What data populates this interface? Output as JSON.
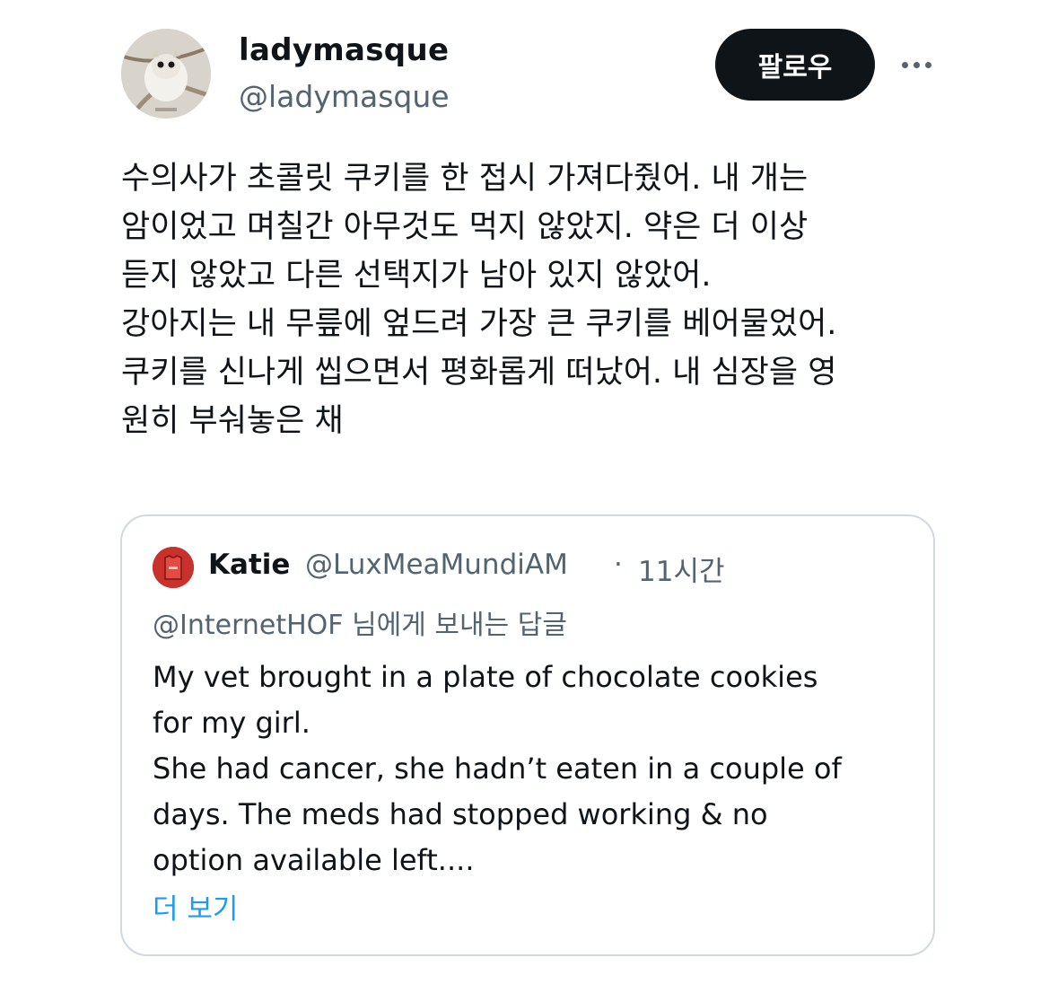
{
  "author": {
    "display_name": "ladymasque",
    "handle": "@ladymasque",
    "avatar_icon": "flying-squirrel-avatar"
  },
  "actions": {
    "follow_label": "팔로우",
    "more_icon": "more-horizontal-icon"
  },
  "tweet": {
    "text": "수의사가 초콜릿 쿠키를 한 접시 가져다줬어. 내 개는\n암이었고 며칠간 아무것도 먹지 않았지. 약은 더 이상\n듣지 않았고 다른 선택지가 남아 있지 않았어.\n강아지는 내 무릎에 엎드려 가장 큰 쿠키를 베어물었어.\n쿠키를 신나게 씹으면서 평화롭게 떠났어. 내 심장을 영\n원히 부숴놓은 채"
  },
  "quote": {
    "name": "Katie",
    "handle": "@LuxMeaMundiAM",
    "separator": "·",
    "time": "11시간",
    "reply_to": "@InternetHOF 님에게 보내는 답글",
    "text": "My vet brought in a plate of chocolate cookies\nfor my girl.\nShe had cancer, she hadn’t eaten in a couple of\ndays. The meds had stopped working & no\noption available left....",
    "show_more": "더 보기",
    "avatar_icon": "red-jersey-avatar"
  },
  "colors": {
    "text_primary": "#0f1419",
    "text_secondary": "#536471",
    "link": "#1d9bf0",
    "follow_bg": "#0f1419",
    "card_border": "#cfd9de"
  }
}
